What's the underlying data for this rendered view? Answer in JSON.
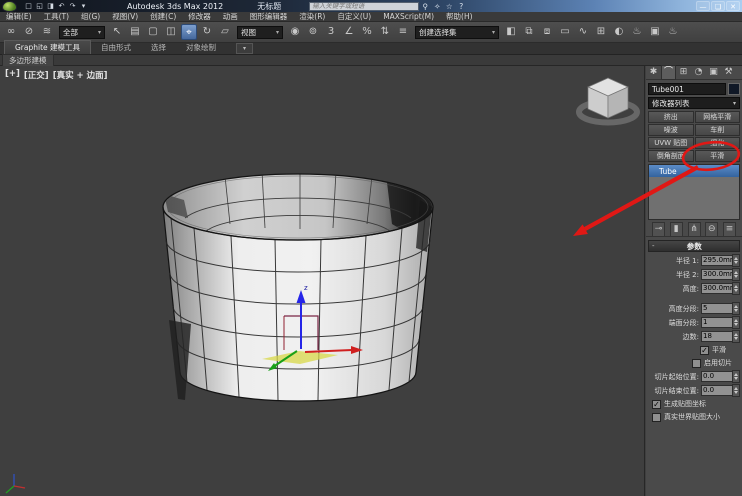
{
  "titlebar": {
    "app_title": "Autodesk 3ds Max 2012",
    "document_title": "无标题",
    "search_placeholder": "输入关键字或短语",
    "window_min": "—",
    "window_max": "❏",
    "window_close": "✕",
    "qat": [
      "□",
      "◱",
      "◨",
      "↶",
      "↷",
      "▾"
    ],
    "infocenter": [
      "⚲",
      "✧",
      "☆",
      "?"
    ]
  },
  "menubar": {
    "items": [
      "编辑(E)",
      "工具(T)",
      "组(G)",
      "视图(V)",
      "创建(C)",
      "修改器",
      "动画",
      "图形编辑器",
      "渲染(R)",
      "自定义(U)",
      "MAXScript(M)",
      "帮助(H)"
    ]
  },
  "toolbar": {
    "selection_filter": "全部",
    "ref_coord": "视图",
    "named_sets": "创建选择集",
    "dropdown_arrow": "▾",
    "icons": [
      "∞",
      "⊘",
      "≋",
      "↖",
      "▤",
      "▢",
      "◫",
      "⌖",
      "↻",
      "▱",
      "◉",
      "⊚",
      "3",
      "∠",
      "%",
      "⇅",
      "≡",
      "◧",
      "⧉",
      "⧈",
      "▭",
      "∿",
      "⊞",
      "◐",
      "♨",
      "▣",
      "♨"
    ]
  },
  "ribbon": {
    "tabs": [
      "Graphite 建模工具",
      "自由形式",
      "选择",
      "对象绘制"
    ],
    "panel_label": "多边形建模",
    "collapse_icon": "▾"
  },
  "viewport": {
    "label_plus": "[+]",
    "label_view": "[正交]",
    "label_shading": "[真实 + 边面]",
    "gizmo_z": "z"
  },
  "command_panel": {
    "tabs": [
      "✱",
      "⌒",
      "⊞",
      "◔",
      "▣",
      "⚒"
    ],
    "object_name": "Tube001",
    "modifier_list_label": "修改器列表",
    "modifier_buttons": [
      "挤出",
      "网格平滑",
      "噪波",
      "车削",
      "UVW 贴图",
      "细化",
      "倒角剖面",
      "平滑"
    ],
    "stack_items": [
      "Tube"
    ],
    "stack_tools": [
      "⊸",
      "▮",
      "⋔",
      "⊖",
      "≡"
    ],
    "parameters": {
      "rollout_title": "参数",
      "rollout_collapse": "-",
      "rows": [
        {
          "label": "半径 1:",
          "value": "295.0mm"
        },
        {
          "label": "半径 2:",
          "value": "300.0mm"
        },
        {
          "label": "高度:",
          "value": "300.0mm"
        },
        {
          "label": "高度分段:",
          "value": "5"
        },
        {
          "label": "端面分段:",
          "value": "1"
        },
        {
          "label": "边数:",
          "value": "18"
        }
      ],
      "smooth_label": "平滑",
      "smooth_checked": true,
      "slice_label": "启用切片",
      "slice_checked": false,
      "slice_rows": [
        {
          "label": "切片起始位置:",
          "value": "0.0"
        },
        {
          "label": "切片结束位置:",
          "value": "0.0"
        }
      ],
      "gen_map_label": "生成贴图坐标",
      "gen_map_checked": true,
      "real_world_label": "真实世界贴图大小",
      "real_world_checked": false,
      "check_glyph": "✓"
    }
  },
  "colors": {
    "annotation_red": "#e01815",
    "selection_blue": "#33639e",
    "toolbar_active_blue": "#45689c"
  }
}
